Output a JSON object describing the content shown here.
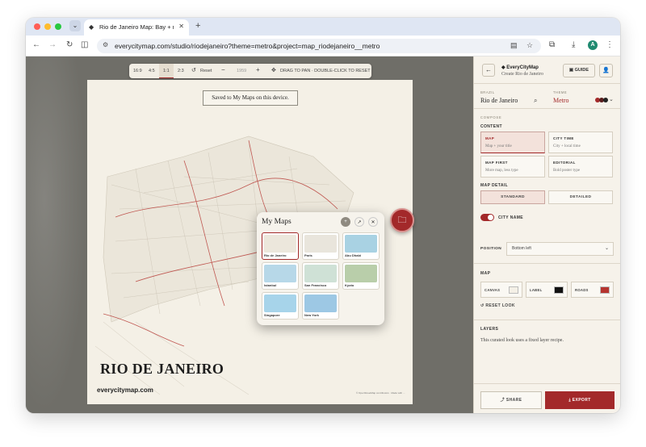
{
  "browser": {
    "tab_title": "Rio de Janeiro Map: Bay + rio",
    "url": "everycitymap.com/studio/riodejaneiro?theme=metro&project=map_riodejaneiro__metro",
    "avatar_letter": "A"
  },
  "toolbar": {
    "ratios": [
      "16:9",
      "4:5",
      "1:1",
      "2:3"
    ],
    "active_ratio": "1:1",
    "reset_label": "Reset",
    "zoom_value": "1959",
    "hint": "DRAG TO PAN · DOUBLE-CLICK TO RESET"
  },
  "poster": {
    "toast": "Saved to My Maps on this device.",
    "title": "RIO DE JANEIRO",
    "site": "everycitymap.com",
    "credit": "© OpenStreetMap contributors · Made with ..."
  },
  "my_maps": {
    "title": "My Maps",
    "items": [
      {
        "label": "Rio de Janeiro",
        "color": "#ece7dc",
        "selected": true
      },
      {
        "label": "Paris",
        "color": "#e9e5dc",
        "selected": false
      },
      {
        "label": "Abu Dhabi",
        "color": "#a9d2e3",
        "selected": false
      },
      {
        "label": "Istanbul",
        "color": "#b7d8e8",
        "selected": false
      },
      {
        "label": "San Francisco",
        "color": "#cfe1d6",
        "selected": false
      },
      {
        "label": "Kyoto",
        "color": "#b9ceaa",
        "selected": false
      },
      {
        "label": "Singapore",
        "color": "#a7d4ea",
        "selected": false
      },
      {
        "label": "New York",
        "color": "#9dc8e4",
        "selected": false
      }
    ]
  },
  "sidebar": {
    "brand": "EveryCityMap",
    "subtitle": "Create Rio de Janeiro",
    "guide_label": "GUIDE",
    "city_caption": "BRAZIL",
    "city_value": "Rio de Janeiro",
    "theme_caption": "THEME",
    "theme_value": "Metro",
    "theme_swatches": [
      "#a3292a",
      "#5a1d1d",
      "#222222"
    ],
    "compose_heading": "COMPOSE",
    "content_heading": "CONTENT",
    "content_options": [
      {
        "title": "MAP",
        "desc": "Map + your title",
        "selected": true
      },
      {
        "title": "CITY TIME",
        "desc": "City + local time",
        "selected": false
      },
      {
        "title": "MAP FIRST",
        "desc": "More map, less type",
        "selected": false
      },
      {
        "title": "EDITORIAL",
        "desc": "Bold poster type",
        "selected": false
      }
    ],
    "detail_heading": "MAP DETAIL",
    "detail_options": [
      "STANDARD",
      "DETAILED"
    ],
    "city_name_label": "CITY NAME",
    "position_label": "POSITION",
    "position_value": "Bottom left",
    "map_heading": "MAP",
    "colors": [
      {
        "label": "CANVAS",
        "color": "#f4f0e6"
      },
      {
        "label": "LABEL",
        "color": "#111111"
      },
      {
        "label": "ROADS",
        "color": "#b5342f"
      }
    ],
    "reset_look": "RESET LOOK",
    "layers_heading": "LAYERS",
    "layers_text": "This curated look uses a fixed layer recipe.",
    "share_label": "SHARE",
    "export_label": "EXPORT"
  }
}
